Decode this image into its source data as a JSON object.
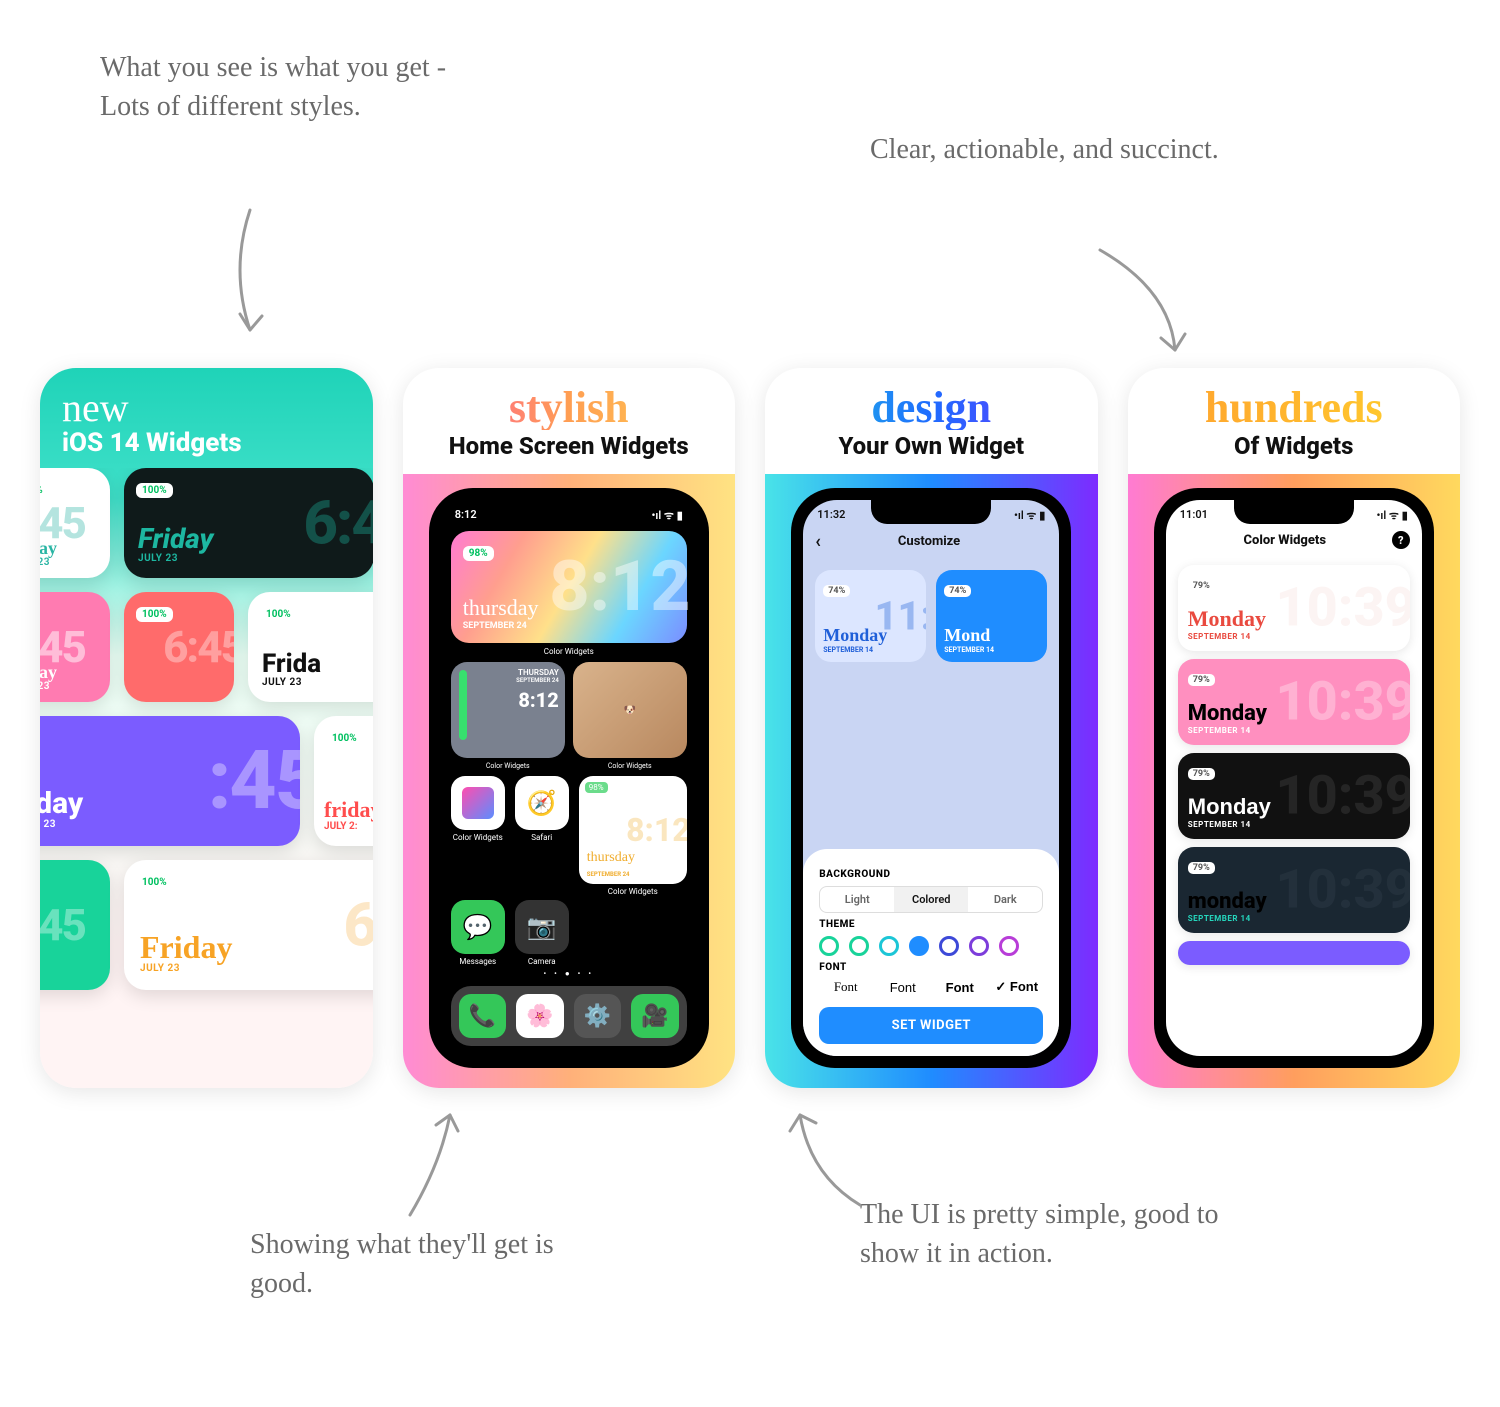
{
  "annotations": {
    "top_left": "What you see is what you get - Lots of different styles.",
    "top_right": "Clear, actionable, and succinct.",
    "bottom_left": "Showing what they'll get is good.",
    "bottom_right": "The UI is pretty simple, good to show it in action."
  },
  "card1": {
    "script": "new",
    "sub": "iOS 14 Widgets",
    "battery": "100%",
    "day": "Friday",
    "day_script": "friday",
    "date": "JULY 23",
    "time_partial_left": "6:45",
    "time_partial_right": "6:4"
  },
  "card2": {
    "script": "stylish",
    "sub": "Home Screen Widgets",
    "status_time": "8:12",
    "big_widget": {
      "battery": "98%",
      "day": "thursday",
      "date": "SEPTEMBER 24",
      "time": "8:12",
      "app_label": "Color Widgets"
    },
    "mini_labels": [
      "Color Widgets",
      "Color Widgets"
    ],
    "mini_thursday": "THURSDAY",
    "mini_date": "SEPTEMBER 24",
    "icons": [
      {
        "label": "Color Widgets"
      },
      {
        "label": "Safari"
      },
      {
        "label": "Color Widgets"
      }
    ],
    "icons_row2": [
      {
        "label": "Messages"
      },
      {
        "label": "Camera"
      },
      {
        "label": "Color Widgets"
      }
    ],
    "small_widget_battery": "98%"
  },
  "card3": {
    "script": "design",
    "sub": "Your Own Widget",
    "status_time": "11:32",
    "screen_title": "Customize",
    "preview_battery": "74%",
    "preview_day": "Monday",
    "preview_day2": "Mond",
    "preview_date": "SEPTEMBER 14",
    "preview_time": "11:",
    "section_background": "BACKGROUND",
    "bg_options": [
      "Light",
      "Colored",
      "Dark"
    ],
    "section_theme": "THEME",
    "theme_colors": [
      "#18d39a",
      "#18d39a",
      "#1cc6d6",
      "#1f8dff",
      "#3d49d8",
      "#7d3ddb",
      "#b83dd8"
    ],
    "theme_selected_index": 3,
    "section_font": "FONT",
    "font_options": [
      "Font",
      "Font",
      "Font",
      "Font"
    ],
    "font_selected_index": 3,
    "button": "SET WIDGET"
  },
  "card4": {
    "script": "hundreds",
    "sub": "Of Widgets",
    "status_time": "11:01",
    "screen_title": "Color Widgets",
    "item_battery": "79%",
    "item_time": "10:39",
    "item_date": "SEPTEMBER 14",
    "items": [
      {
        "day": "Monday",
        "bg": "#ffffff",
        "day_color": "#e94a3f",
        "time_color": "#f3d9d6",
        "date_color": "#e94a3f",
        "font": "serif"
      },
      {
        "day": "Monday",
        "bg": "#ff8fbf",
        "day_color": "#ffffff",
        "time_color": "#ffffff",
        "date_color": "#ffffff",
        "font": "script"
      },
      {
        "day": "Monday",
        "bg": "#111111",
        "day_color": "#ffffff",
        "time_color": "#555555",
        "date_color": "#ffffff",
        "font": "sans"
      },
      {
        "day": "monday",
        "bg": "#1a2732",
        "day_color": "#25d6bd",
        "time_color": "#3a4753",
        "date_color": "#25d6bd",
        "font": "script"
      }
    ]
  }
}
